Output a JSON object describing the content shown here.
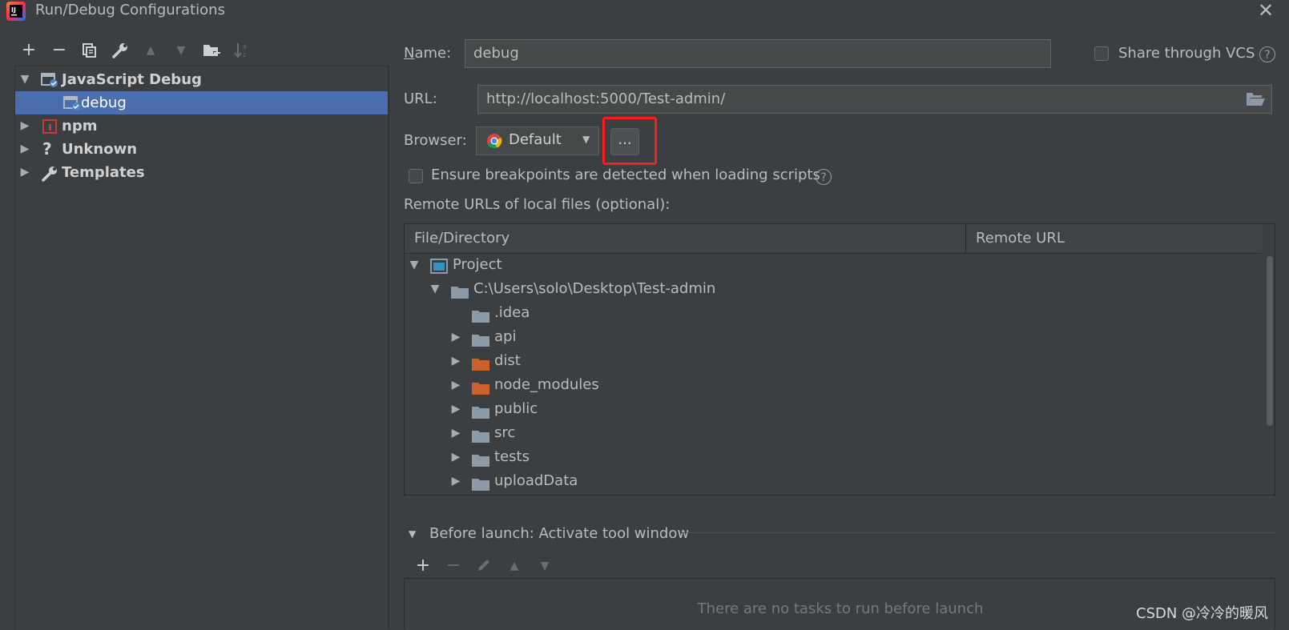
{
  "window": {
    "title": "Run/Debug Configurations",
    "logo_text": "IJ",
    "close_glyph": "✕"
  },
  "left_toolbar": {
    "add": "+",
    "remove": "−",
    "copy_icon": "copy-icon",
    "edit_icon": "wrench-icon",
    "move_up": "▲",
    "move_down": "▼",
    "new_folder_icon": "folder-add-icon",
    "sort_icon": "sort-icon"
  },
  "config_tree": {
    "items": [
      {
        "label": "JavaScript Debug",
        "expanded": true,
        "icon": "javascript-debug-icon"
      },
      {
        "label": "debug",
        "selected": true,
        "icon": "javascript-debug-icon"
      },
      {
        "label": "npm",
        "expanded": false,
        "icon": "npm-icon"
      },
      {
        "label": "Unknown",
        "expanded": false,
        "icon": "question-icon"
      },
      {
        "label": "Templates",
        "expanded": false,
        "icon": "wrench-icon"
      }
    ]
  },
  "form": {
    "name_label": "Name:",
    "name_value": "debug",
    "share_vcs_label": "Share through VCS",
    "share_vcs_checked": false,
    "url_label": "URL:",
    "url_value": "http://localhost:5000/Test-admin/",
    "browser_label": "Browser:",
    "browser_value": "Default",
    "browser_more": "...",
    "ensure_breakpoints_label": "Ensure breakpoints are detected when loading scripts",
    "ensure_breakpoints_checked": false,
    "remote_urls_label": "Remote URLs of local files (optional):"
  },
  "remote_table": {
    "columns": [
      "File/Directory",
      "Remote URL"
    ],
    "rows": [
      {
        "label": "Project",
        "indent": 0,
        "arrow": "▼",
        "icon": "project-icon"
      },
      {
        "label": "C:\\Users\\solo\\Desktop\\Test-admin",
        "indent": 1,
        "arrow": "▼",
        "icon": "folder-icon"
      },
      {
        "label": ".idea",
        "indent": 2,
        "arrow": "",
        "icon": "folder-icon"
      },
      {
        "label": "api",
        "indent": 2,
        "arrow": "▶",
        "icon": "folder-icon"
      },
      {
        "label": "dist",
        "indent": 2,
        "arrow": "▶",
        "icon": "excluded-folder-icon"
      },
      {
        "label": "node_modules",
        "indent": 2,
        "arrow": "▶",
        "icon": "excluded-folder-icon"
      },
      {
        "label": "public",
        "indent": 2,
        "arrow": "▶",
        "icon": "folder-icon"
      },
      {
        "label": "src",
        "indent": 2,
        "arrow": "▶",
        "icon": "folder-icon"
      },
      {
        "label": "tests",
        "indent": 2,
        "arrow": "▶",
        "icon": "folder-icon"
      },
      {
        "label": "uploadData",
        "indent": 2,
        "arrow": "▶",
        "icon": "folder-icon"
      }
    ]
  },
  "before_launch": {
    "title": "Before launch: Activate tool window",
    "add": "+",
    "remove": "−",
    "empty_text": "There are no tasks to run before launch"
  },
  "watermark": "CSDN @冷冷的暖风",
  "colors": {
    "background": "#3c3f41",
    "selection": "#4b6eaf",
    "highlight": "#ff1a1a",
    "excluded_folder": "#c9622d",
    "folder": "#8c9aa8"
  }
}
